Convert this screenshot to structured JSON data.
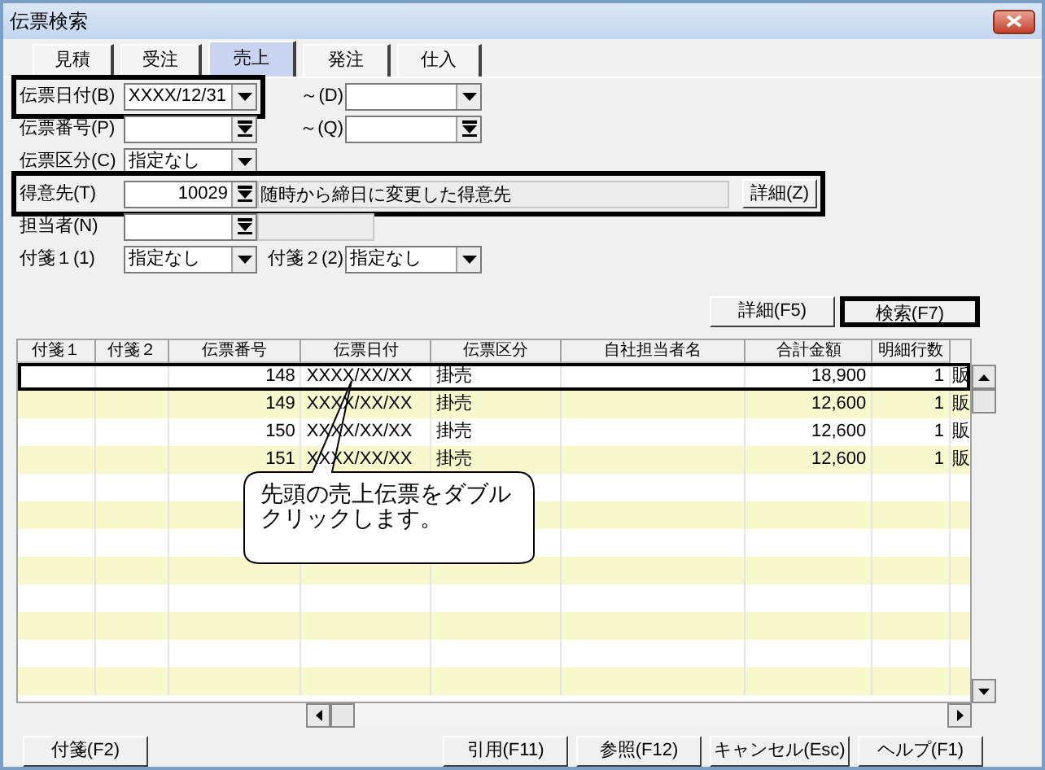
{
  "window": {
    "title": "伝票検索"
  },
  "tabs": [
    {
      "label": "見積",
      "selected": false
    },
    {
      "label": "受注",
      "selected": false
    },
    {
      "label": "売上",
      "selected": true
    },
    {
      "label": "発注",
      "selected": false
    },
    {
      "label": "仕入",
      "selected": false
    }
  ],
  "form_rows": [
    {
      "highlighted": false,
      "items": [
        {
          "kind": "combo",
          "label": "伝票日付(B)",
          "value": "XXXX/12/31",
          "highlighted": true
        },
        {
          "kind": "combo",
          "label": "～(D)",
          "highlighted": false
        }
      ]
    },
    {
      "highlighted": false,
      "items": [
        {
          "kind": "lookup",
          "label": "伝票番号(P)",
          "highlighted": false
        },
        {
          "kind": "lookup",
          "label": "～(Q)",
          "highlighted": false
        }
      ]
    },
    {
      "highlighted": false,
      "items": [
        {
          "kind": "combo",
          "label": "伝票区分(C)",
          "value": "指定なし",
          "highlighted": false
        }
      ]
    },
    {
      "highlighted": true,
      "items": [
        {
          "kind": "lookup",
          "label": "得意先(T)",
          "value": "10029",
          "highlighted": false
        },
        {
          "kind": "display",
          "value": "随時から締日に変更した得意先"
        },
        {
          "kind": "button",
          "label": "詳細(Z)"
        }
      ]
    },
    {
      "highlighted": false,
      "items": [
        {
          "kind": "lookup",
          "label": "担当者(N)",
          "highlighted": false
        },
        {
          "kind": "display"
        }
      ]
    },
    {
      "highlighted": false,
      "items": [
        {
          "kind": "combo",
          "label": "付箋１(1)",
          "value": "指定なし",
          "highlighted": false
        },
        {
          "kind": "combo",
          "label": "付箋２(2)",
          "value": "指定なし",
          "highlighted": false
        }
      ]
    }
  ],
  "search_buttons": [
    {
      "label": "詳細(F5)",
      "highlighted": false
    },
    {
      "label": "検索(F7)",
      "highlighted": true
    }
  ],
  "table": {
    "columns": [
      "付箋１",
      "付箋２",
      "伝票番号",
      "伝票日付",
      "伝票区分",
      "自社担当者名",
      "合計金額",
      "明細行数"
    ],
    "rows": [
      {
        "selected": true,
        "cells": [
          "",
          "",
          "148",
          "XXXX/XX/XX",
          "掛売",
          "",
          "18,900",
          "1",
          "販"
        ]
      },
      {
        "selected": false,
        "cells": [
          "",
          "",
          "149",
          "XXXX/XX/XX",
          "掛売",
          "",
          "12,600",
          "1",
          "販"
        ]
      },
      {
        "selected": false,
        "cells": [
          "",
          "",
          "150",
          "XXXX/XX/XX",
          "掛売",
          "",
          "12,600",
          "1",
          "販"
        ]
      },
      {
        "selected": false,
        "cells": [
          "",
          "",
          "151",
          "XXXX/XX/XX",
          "掛売",
          "",
          "12,600",
          "1",
          "販"
        ]
      }
    ]
  },
  "callout": {
    "text": "先頭の売上伝票をダブルクリックします。"
  },
  "bottom_buttons": [
    {
      "label": "付箋(F2)"
    },
    {
      "label": "引用(F11)"
    },
    {
      "label": "参照(F12)"
    },
    {
      "label": "キャンセル(Esc)"
    },
    {
      "label": "ヘルプ(F1)"
    }
  ]
}
